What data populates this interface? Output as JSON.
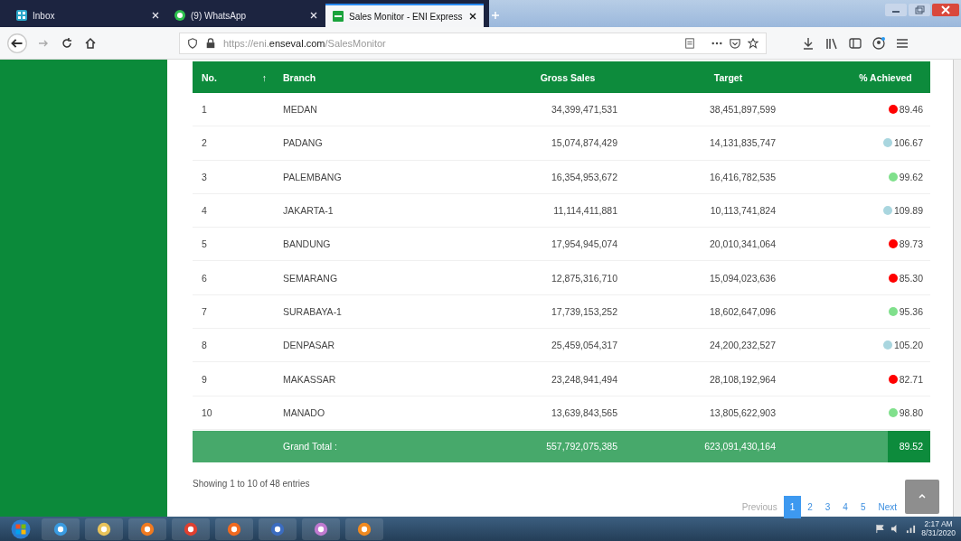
{
  "browser": {
    "tabs": [
      {
        "label": "Inbox",
        "kind": "mail",
        "selected": false
      },
      {
        "label": "(9) WhatsApp",
        "kind": "chat",
        "selected": false
      },
      {
        "label": "Sales Monitor - ENI Express",
        "kind": "site",
        "selected": true
      }
    ],
    "url": {
      "prefix": "https://eni.",
      "domain": "enseval.com",
      "path": "/SalesMonitor"
    }
  },
  "table": {
    "columns": [
      {
        "label": "No.",
        "sort": "↑"
      },
      {
        "label": "Branch"
      },
      {
        "label": "Gross Sales"
      },
      {
        "label": "Target"
      },
      {
        "label": "% Achieved"
      }
    ],
    "rows": [
      {
        "no": "1",
        "branch": "MEDAN",
        "gross": "34,399,471,531",
        "target": "38,451,897,599",
        "achieved": "89.46",
        "color": "#ff0000"
      },
      {
        "no": "2",
        "branch": "PADANG",
        "gross": "15,074,874,429",
        "target": "14,131,835,747",
        "achieved": "106.67",
        "color": "#a9d6df"
      },
      {
        "no": "3",
        "branch": "PALEMBANG",
        "gross": "16,354,953,672",
        "target": "16,416,782,535",
        "achieved": "99.62",
        "color": "#80e08c"
      },
      {
        "no": "4",
        "branch": "JAKARTA-1",
        "gross": "11,114,411,881",
        "target": "10,113,741,824",
        "achieved": "109.89",
        "color": "#a9d6df"
      },
      {
        "no": "5",
        "branch": "BANDUNG",
        "gross": "17,954,945,074",
        "target": "20,010,341,064",
        "achieved": "89.73",
        "color": "#ff0000"
      },
      {
        "no": "6",
        "branch": "SEMARANG",
        "gross": "12,875,316,710",
        "target": "15,094,023,636",
        "achieved": "85.30",
        "color": "#ff0000"
      },
      {
        "no": "7",
        "branch": "SURABAYA-1",
        "gross": "17,739,153,252",
        "target": "18,602,647,096",
        "achieved": "95.36",
        "color": "#80e08c"
      },
      {
        "no": "8",
        "branch": "DENPASAR",
        "gross": "25,459,054,317",
        "target": "24,200,232,527",
        "achieved": "105.20",
        "color": "#a9d6df"
      },
      {
        "no": "9",
        "branch": "MAKASSAR",
        "gross": "23,248,941,494",
        "target": "28,108,192,964",
        "achieved": "82.71",
        "color": "#ff0000"
      },
      {
        "no": "10",
        "branch": "MANADO",
        "gross": "13,639,843,565",
        "target": "13,805,622,903",
        "achieved": "98.80",
        "color": "#80e08c"
      }
    ],
    "total": {
      "label": "Grand Total :",
      "gross": "557,792,075,385",
      "target": "623,091,430,164",
      "achieved": "89.52"
    }
  },
  "info": "Showing 1 to 10 of 48 entries",
  "pagination": {
    "previous": "Previous",
    "next": "Next",
    "pages": [
      {
        "label": "1",
        "selected": true
      },
      {
        "label": "2",
        "selected": false
      },
      {
        "label": "3",
        "selected": false
      },
      {
        "label": "4",
        "selected": false
      },
      {
        "label": "5",
        "selected": false
      }
    ]
  },
  "taskbar": {
    "apps": [
      {
        "kind": "start"
      },
      {
        "kind": "ie"
      },
      {
        "kind": "explorer"
      },
      {
        "kind": "media"
      },
      {
        "kind": "chrome"
      },
      {
        "kind": "firefox"
      },
      {
        "kind": "word"
      },
      {
        "kind": "paint"
      },
      {
        "kind": "app"
      }
    ],
    "time": "2:17 AM",
    "date": "8/31/2020"
  }
}
